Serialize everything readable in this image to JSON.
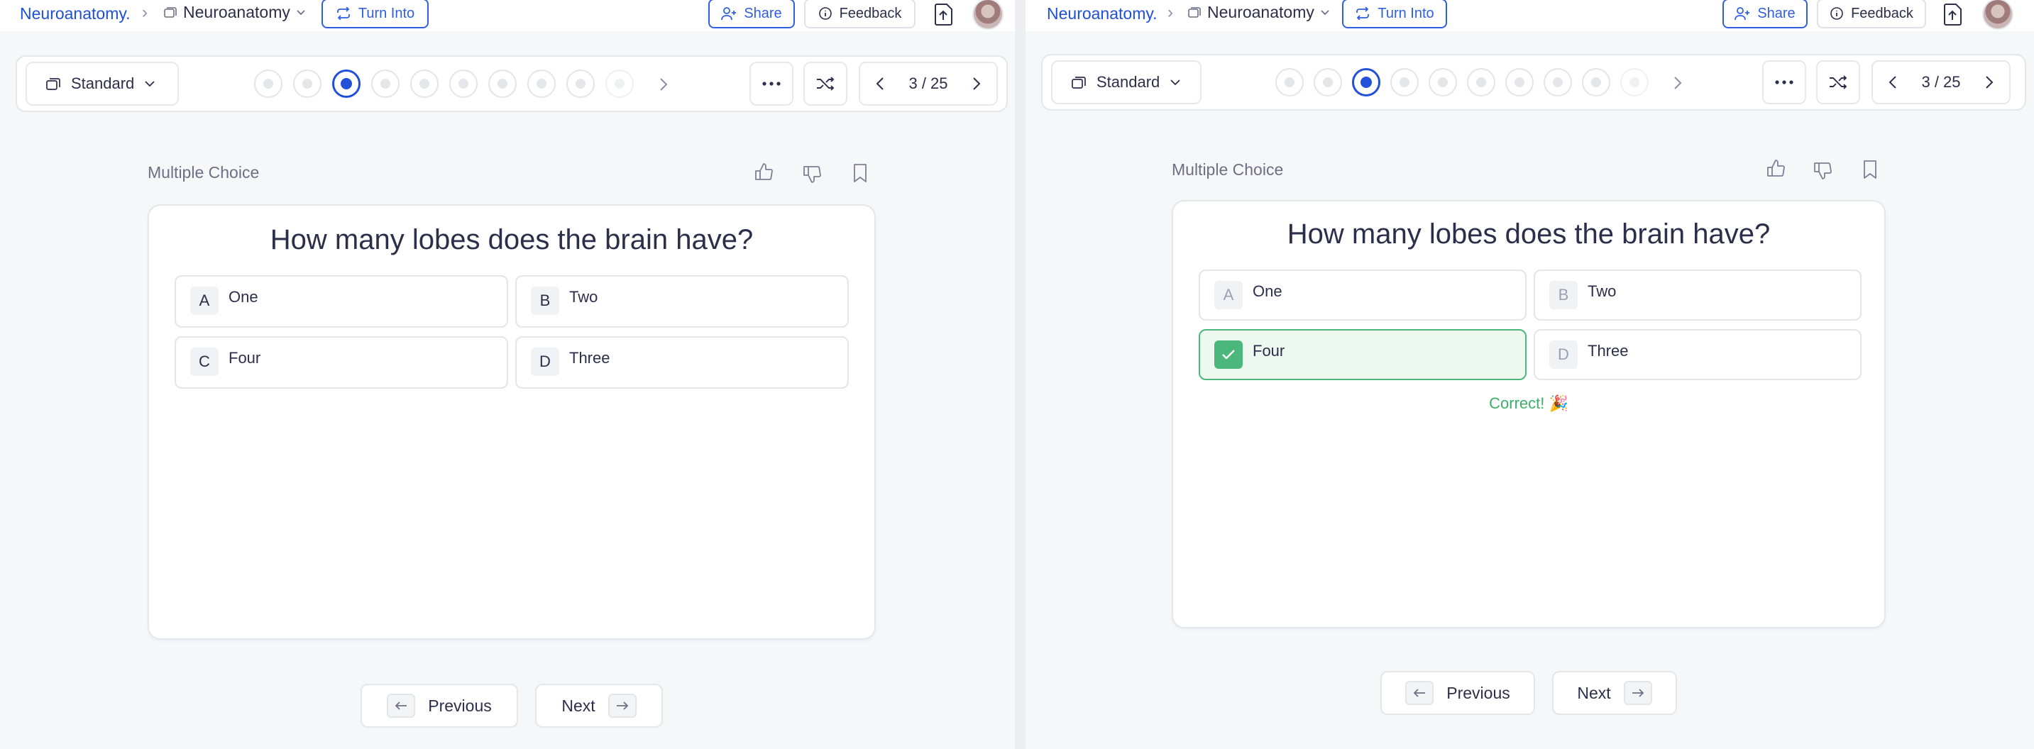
{
  "topbar": {
    "brand": "Neuroanatomy.",
    "deck_name": "Neuroanatomy",
    "turn_into_label": "Turn Into",
    "share_label": "Share",
    "feedback_label": "Feedback"
  },
  "toolbar": {
    "mode": "Standard",
    "counter": "3 / 25",
    "progress_dots": 10,
    "active_dot": 3
  },
  "question": {
    "type_label": "Multiple Choice",
    "text": "How many lobes does the brain have?",
    "options": [
      {
        "letter": "A",
        "text": "One"
      },
      {
        "letter": "B",
        "text": "Two"
      },
      {
        "letter": "C",
        "text": "Four"
      },
      {
        "letter": "D",
        "text": "Three"
      }
    ],
    "correct_feedback": "Correct! 🎉"
  },
  "navigation": {
    "previous_label": "Previous",
    "next_label": "Next"
  },
  "colors": {
    "accent": "#2350d8",
    "correct": "#4cb77a",
    "background": "#f6f7f9"
  }
}
